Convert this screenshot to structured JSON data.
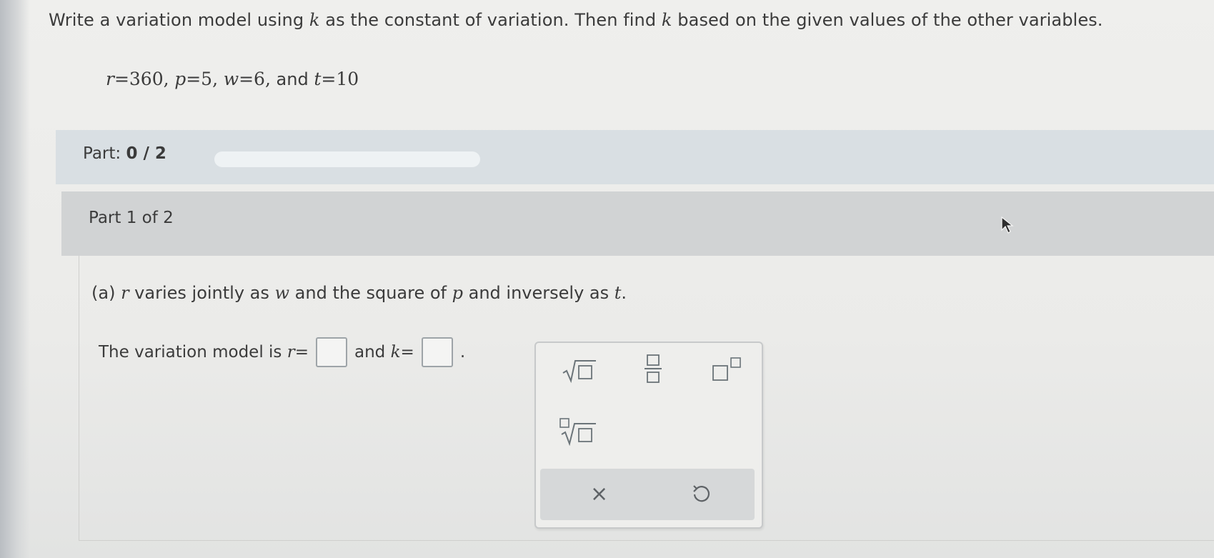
{
  "question": {
    "prefix": "Write a variation model using ",
    "var_k1": "k",
    "middle": " as the constant of variation. Then find ",
    "var_k2": "k",
    "suffix": " based on the given values of the other variables."
  },
  "given": {
    "r_var": "r",
    "r_val": "=360,",
    "p_var": "p",
    "p_val": "=5,",
    "w_var": "w",
    "w_val": "=6,",
    "and": "and",
    "t_var": "t",
    "t_val": "=10"
  },
  "progress_header": {
    "label": "Part:",
    "value": "0 / 2",
    "progress_fraction": 0
  },
  "part_section": {
    "label": "Part 1 of 2"
  },
  "part_a": {
    "prefix": "(a) ",
    "r": "r",
    "t1": " varies jointly as ",
    "w": "w",
    "t2": " and the square of ",
    "p": "p",
    "t3": " and inversely as ",
    "t": "t",
    "t4": "."
  },
  "model_line": {
    "prefix": "The variation model is ",
    "r": "r",
    "eq1": "=",
    "and": "and",
    "k": "k",
    "eq2": "=",
    "period": "."
  },
  "palette": {
    "buttons": [
      "square-root",
      "fraction",
      "exponent",
      "nth-root"
    ],
    "clear_label": "×",
    "undo_icon": "undo-icon"
  },
  "colors": {
    "part_bar": "#d9dfe3",
    "part_section": "#d1d3d4",
    "palette_footer": "#d6d8d9"
  }
}
